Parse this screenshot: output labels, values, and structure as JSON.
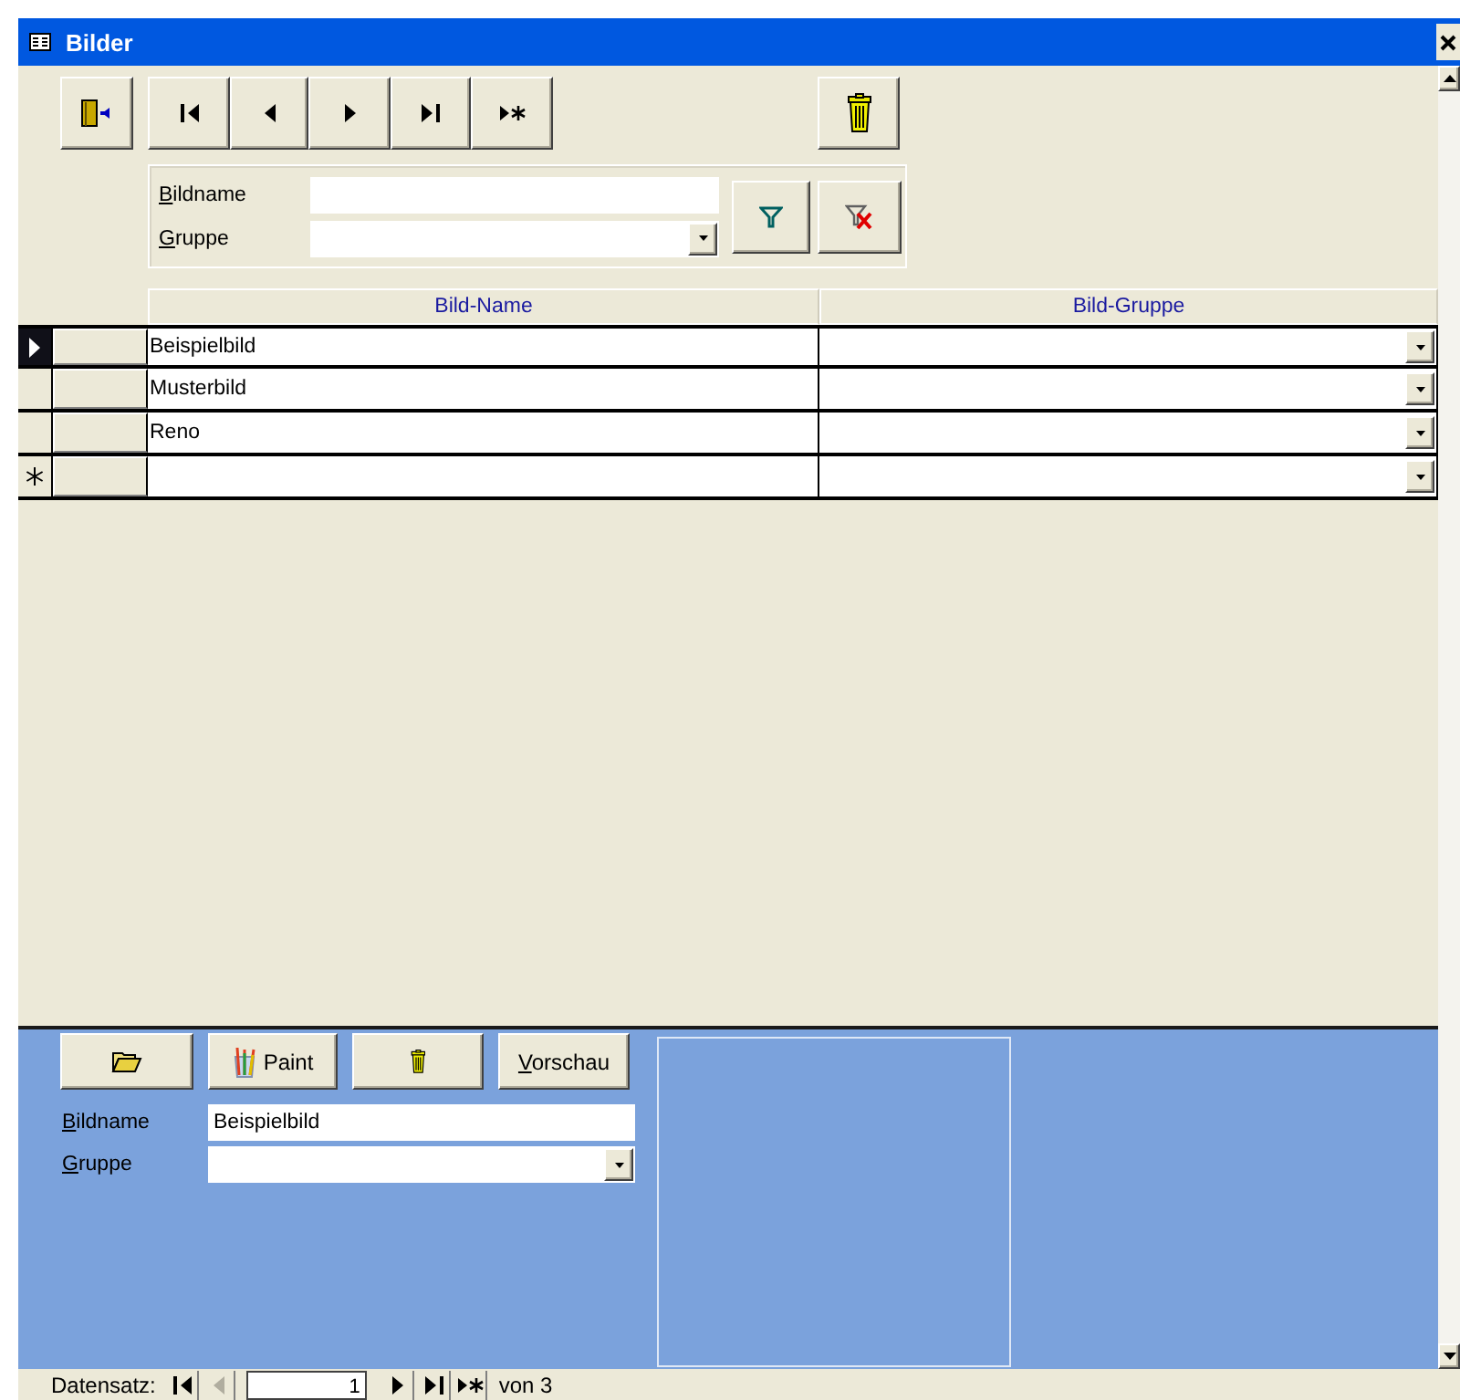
{
  "window": {
    "title": "Bilder"
  },
  "filter": {
    "fields": [
      {
        "label": "Bildname",
        "kind": "text"
      },
      {
        "label": "Gruppe",
        "kind": "combo"
      }
    ]
  },
  "grid": {
    "columns": [
      "Bild-Name",
      "Bild-Gruppe"
    ],
    "rows": [
      {
        "kind": "record",
        "name": "Beispielbild",
        "selected": true
      },
      {
        "kind": "record",
        "name": "Musterbild",
        "selected": false
      },
      {
        "kind": "record",
        "name": "Reno",
        "selected": false
      },
      {
        "kind": "new",
        "selected": false
      }
    ]
  },
  "detail": {
    "paint_button": {
      "label": "Paint"
    },
    "preview_button": {
      "label": "Vorschau"
    },
    "fields": [
      {
        "label": "Bildname",
        "kind": "text",
        "value": "Beispielbild"
      },
      {
        "label": "Gruppe",
        "kind": "combo"
      }
    ]
  },
  "record_nav": {
    "label": "Datensatz:",
    "current": "1",
    "total": "von 3",
    "buttons": [
      {
        "kind": "first",
        "disabled": false
      },
      {
        "kind": "prev",
        "disabled": true
      },
      {
        "kind": "next",
        "disabled": false
      },
      {
        "kind": "last",
        "disabled": false
      },
      {
        "kind": "new",
        "disabled": false
      }
    ]
  }
}
